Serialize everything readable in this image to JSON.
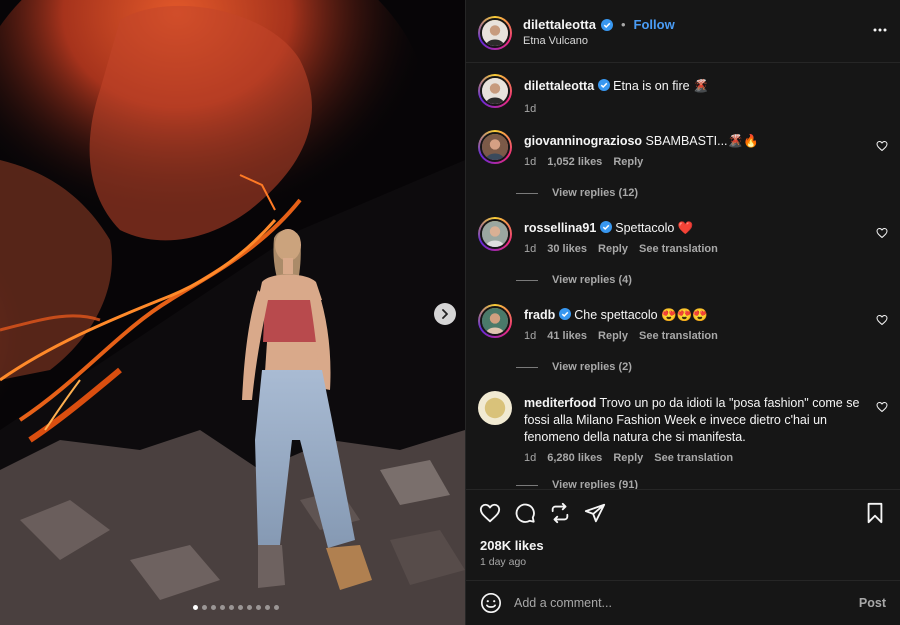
{
  "header": {
    "username": "dilettaleotta",
    "follow_label": "Follow",
    "location": "Etna Vulcano",
    "separator": "•"
  },
  "caption": {
    "username": "dilettaleotta",
    "text": "Etna is on fire 🌋",
    "time": "1d"
  },
  "comments": [
    {
      "username": "giovanninograzioso",
      "verified": false,
      "text": "SBAMBASTI...🌋🔥",
      "time": "1d",
      "likes": "1,052 likes",
      "reply": "Reply",
      "translate": "",
      "replies": "View replies (12)"
    },
    {
      "username": "rossellina91",
      "verified": true,
      "text": "Spettacolo ❤️",
      "time": "1d",
      "likes": "30 likes",
      "reply": "Reply",
      "translate": "See translation",
      "replies": "View replies (4)"
    },
    {
      "username": "fradb",
      "verified": true,
      "text": "Che spettacolo 😍😍😍",
      "time": "1d",
      "likes": "41 likes",
      "reply": "Reply",
      "translate": "See translation",
      "replies": "View replies (2)"
    },
    {
      "username": "mediterfood",
      "verified": false,
      "text": "Trovo un po da idioti la \"posa fashion\" come se fossi alla Milano Fashion Week e invece dietro c'hai un fenomeno della natura che si manifesta.",
      "time": "1d",
      "likes": "6,280 likes",
      "reply": "Reply",
      "translate": "See translation",
      "replies": "View replies (91)"
    }
  ],
  "post_stats": {
    "likes": "208K likes",
    "time_ago": "1 day ago"
  },
  "composer": {
    "placeholder": "Add a comment...",
    "post_label": "Post"
  },
  "carousel": {
    "total_slides": 10,
    "current_slide": 1
  },
  "colors": {
    "link": "#4a9cf5",
    "verified": "#3897f0",
    "panel_bg": "#161616"
  }
}
